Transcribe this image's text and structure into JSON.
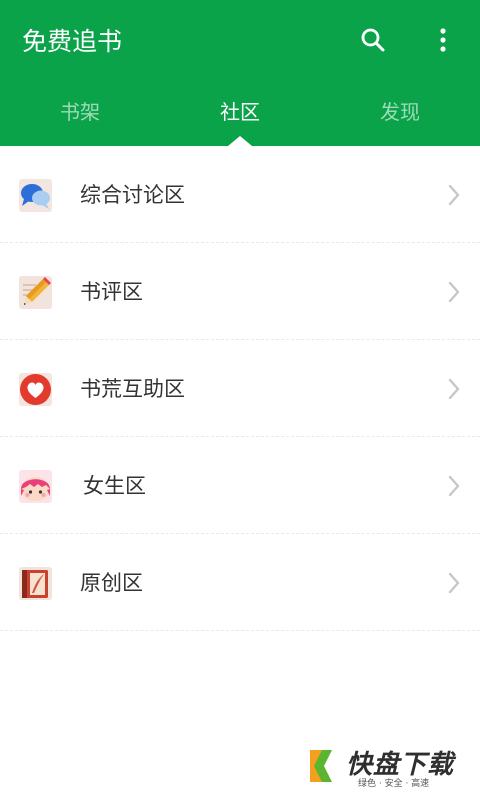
{
  "app": {
    "title": "免费追书"
  },
  "tabs": [
    {
      "label": "书架"
    },
    {
      "label": "社区"
    },
    {
      "label": "发现"
    }
  ],
  "list": {
    "items": [
      {
        "label": "综合讨论区",
        "icon": "chat-bubbles-icon"
      },
      {
        "label": "书评区",
        "icon": "pencil-paper-icon"
      },
      {
        "label": "书荒互助区",
        "icon": "heart-icon"
      },
      {
        "label": "女生区",
        "icon": "girl-face-icon"
      },
      {
        "label": "原创区",
        "icon": "notebook-quill-icon"
      }
    ]
  },
  "watermark": {
    "brand": "快盘下载",
    "tagline": "绿色 · 安全 · 高速"
  },
  "colors": {
    "accent": "#0aa34a",
    "text": "#333333",
    "chevron": "#c7c7c7"
  }
}
